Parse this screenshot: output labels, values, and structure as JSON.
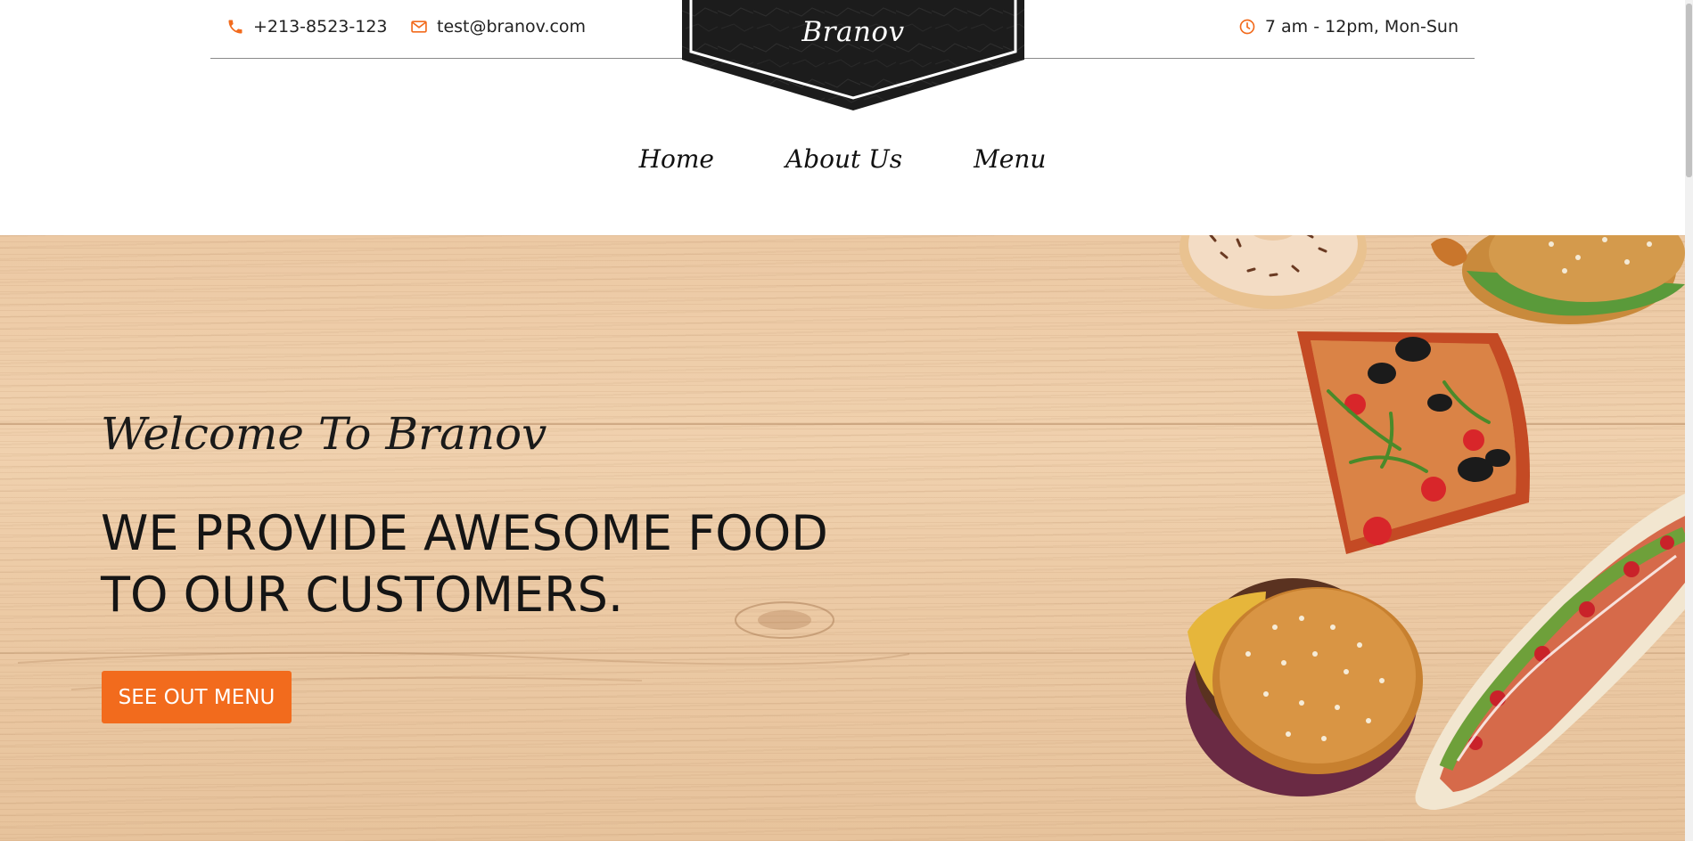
{
  "header": {
    "phone": "+213-8523-123",
    "email": "test@branov.com",
    "hours": "7 am - 12pm, Mon-Sun",
    "icons": [
      "phone-icon",
      "envelope-icon",
      "clock-icon"
    ],
    "accent_color": "#f26b1d"
  },
  "logo": {
    "text": "Branov",
    "badge_color": "#1c1c1c"
  },
  "nav": {
    "items": [
      "Home",
      "About Us",
      "Menu"
    ]
  },
  "hero": {
    "subtitle": "Welcome To Branov",
    "title_line1": "WE PROVIDE AWESOME FOOD",
    "title_line2": "TO OUR CUSTOMERS.",
    "cta_label": "SEE OUT MENU",
    "images": [
      "donut-image",
      "chicken-burger-image",
      "pizza-slice-image",
      "burger-image",
      "hotdog-image"
    ]
  }
}
